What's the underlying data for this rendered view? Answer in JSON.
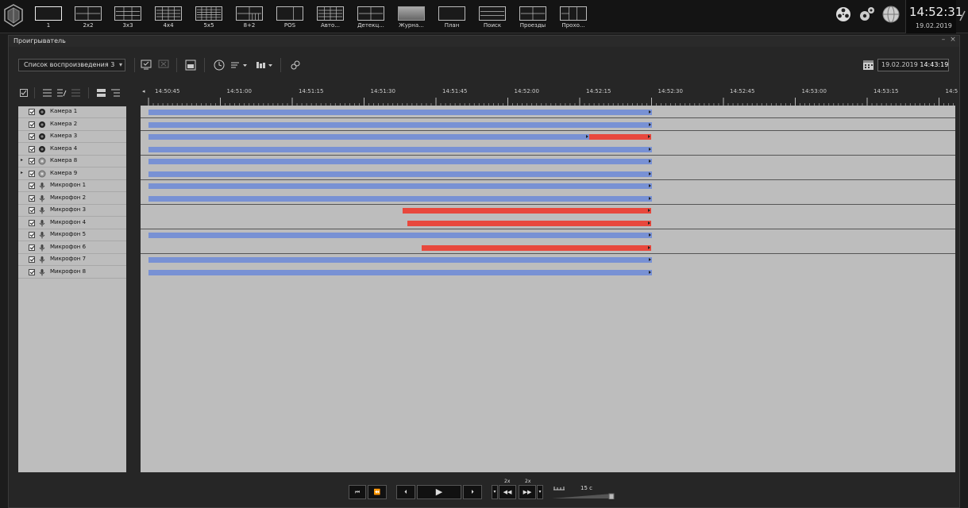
{
  "layouts": [
    {
      "label": "1",
      "kind": "1"
    },
    {
      "label": "2x2",
      "kind": "2x2"
    },
    {
      "label": "3x3",
      "kind": "3x3"
    },
    {
      "label": "4x4",
      "kind": "4x4"
    },
    {
      "label": "5x5",
      "kind": "5x5"
    },
    {
      "label": "8+2",
      "kind": "8p2"
    },
    {
      "label": "POS",
      "kind": "pos"
    },
    {
      "label": "Авто...",
      "kind": "4x4b"
    },
    {
      "label": "Детекц...",
      "kind": "2x2b"
    },
    {
      "label": "Журна...",
      "kind": "grey"
    },
    {
      "label": "План",
      "kind": "1"
    },
    {
      "label": "Поиск",
      "kind": "search"
    },
    {
      "label": "Проезды",
      "kind": "2x2b"
    },
    {
      "label": "Прохо...",
      "kind": "3v"
    }
  ],
  "clock": {
    "time": "14:52:31",
    "date": "19.02.2019"
  },
  "window": {
    "title": "Проигрыватель",
    "minimize": "–",
    "close": "×"
  },
  "toolbar": {
    "playlist": "Список воспроизведения 3",
    "date": "19.02.2019",
    "time": "14:43:19"
  },
  "timeline": {
    "ticks": [
      "14:50:45",
      "14:51:00",
      "14:51:15",
      "14:51:30",
      "14:51:45",
      "14:52:00",
      "14:52:15",
      "14:52:30",
      "14:52:45",
      "14:53:00",
      "14:53:15",
      "14:5"
    ],
    "scroll_left": "◂"
  },
  "sources": [
    {
      "name": "Камера 1",
      "type": "camera",
      "expand": false,
      "recordings": [
        {
          "color": "blue",
          "start": "14:50:45",
          "end": "14:52:30"
        }
      ]
    },
    {
      "name": "Камера 2",
      "type": "camera",
      "expand": false,
      "recordings": [
        {
          "color": "blue",
          "start": "14:50:45",
          "end": "14:52:30"
        }
      ]
    },
    {
      "name": "Камера 3",
      "type": "camera",
      "expand": false,
      "recordings": [
        {
          "color": "blue",
          "start": "14:50:45",
          "end": "14:52:17"
        },
        {
          "color": "red",
          "start": "14:52:17",
          "end": "14:52:30"
        }
      ]
    },
    {
      "name": "Камера 4",
      "type": "camera",
      "expand": false,
      "recordings": [
        {
          "color": "blue",
          "start": "14:50:45",
          "end": "14:52:30"
        }
      ]
    },
    {
      "name": "Камера 8",
      "type": "camera-off",
      "expand": true,
      "recordings": [
        {
          "color": "blue",
          "start": "14:50:45",
          "end": "14:52:30"
        }
      ]
    },
    {
      "name": "Камера 9",
      "type": "camera-off",
      "expand": true,
      "recordings": [
        {
          "color": "blue",
          "start": "14:50:45",
          "end": "14:52:30"
        }
      ]
    },
    {
      "name": "Микрофон 1",
      "type": "mic",
      "expand": false,
      "recordings": [
        {
          "color": "blue",
          "start": "14:50:45",
          "end": "14:52:30"
        }
      ]
    },
    {
      "name": "Микрофон 2",
      "type": "mic",
      "expand": false,
      "recordings": [
        {
          "color": "blue",
          "start": "14:50:45",
          "end": "14:52:30"
        }
      ]
    },
    {
      "name": "Микрофон 3",
      "type": "mic",
      "expand": false,
      "recordings": [
        {
          "color": "red",
          "start": "14:51:38",
          "end": "14:52:30"
        }
      ]
    },
    {
      "name": "Микрофон 4",
      "type": "mic",
      "expand": false,
      "recordings": [
        {
          "color": "red",
          "start": "14:51:39",
          "end": "14:52:30"
        }
      ]
    },
    {
      "name": "Микрофон 5",
      "type": "mic",
      "expand": false,
      "recordings": [
        {
          "color": "blue",
          "start": "14:50:45",
          "end": "14:52:30"
        }
      ]
    },
    {
      "name": "Микрофон 6",
      "type": "mic",
      "expand": false,
      "recordings": [
        {
          "color": "red",
          "start": "14:51:42",
          "end": "14:52:30"
        }
      ]
    },
    {
      "name": "Микрофон 7",
      "type": "mic",
      "expand": false,
      "recordings": [
        {
          "color": "blue",
          "start": "14:50:45",
          "end": "14:52:30"
        }
      ]
    },
    {
      "name": "Микрофон 8",
      "type": "mic",
      "expand": false,
      "recordings": [
        {
          "color": "blue",
          "start": "14:50:45",
          "end": "14:52:30"
        }
      ]
    }
  ],
  "transport": {
    "prev_frame": "⏮",
    "prev_segment": "⏪",
    "step_back": "⏴",
    "play": "▶",
    "step_forward": "⏵",
    "speed_back": "2x",
    "speed_fwd": "2x",
    "rewind": "◀◀",
    "forward": "▶▶",
    "step": "15 с"
  },
  "colors": {
    "recording": "#7891d4",
    "alarm": "#e8483d"
  }
}
